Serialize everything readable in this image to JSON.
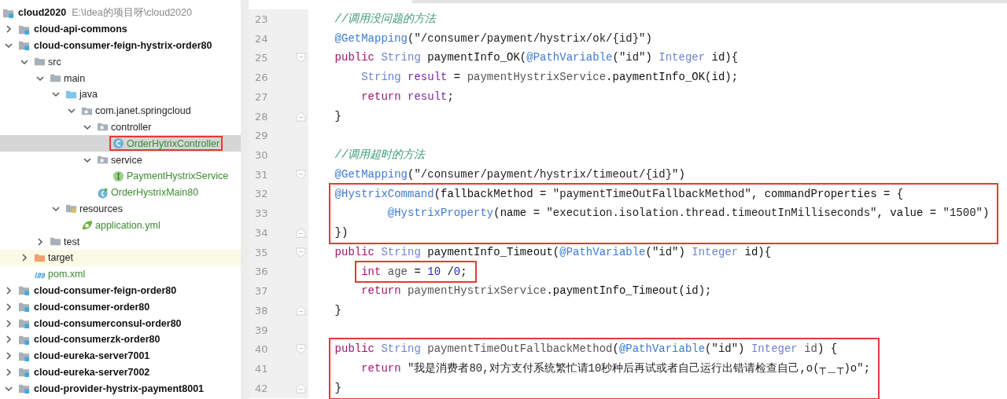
{
  "project": {
    "label": "cloud2020",
    "path": "E:\\Idea的项目呀\\cloud2020",
    "children": [
      {
        "label": "cloud-api-commons",
        "kind": "module",
        "expanded": false,
        "selected": false,
        "tinted": false,
        "boxed": false,
        "added": false
      },
      {
        "label": "cloud-consumer-feign-hystrix-order80",
        "kind": "module",
        "expanded": true,
        "selected": false,
        "tinted": false,
        "boxed": false,
        "added": false,
        "children": [
          {
            "label": "src",
            "kind": "folder",
            "expanded": true,
            "selected": false,
            "tinted": false,
            "boxed": false,
            "added": false,
            "children": [
              {
                "label": "main",
                "kind": "folder",
                "expanded": true,
                "selected": false,
                "tinted": false,
                "boxed": false,
                "added": false,
                "children": [
                  {
                    "label": "java",
                    "kind": "source-root",
                    "expanded": true,
                    "selected": false,
                    "tinted": false,
                    "boxed": false,
                    "added": false,
                    "children": [
                      {
                        "label": "com.janet.springcloud",
                        "kind": "package",
                        "expanded": true,
                        "selected": false,
                        "tinted": false,
                        "boxed": false,
                        "added": false,
                        "children": [
                          {
                            "label": "controller",
                            "kind": "package",
                            "expanded": true,
                            "selected": false,
                            "tinted": false,
                            "boxed": false,
                            "added": false,
                            "children": [
                              {
                                "label": "OrderHytrixController",
                                "kind": "class",
                                "selected": true,
                                "tinted": false,
                                "boxed": true,
                                "added": true
                              }
                            ]
                          },
                          {
                            "label": "service",
                            "kind": "package",
                            "expanded": true,
                            "selected": false,
                            "tinted": false,
                            "boxed": false,
                            "added": false,
                            "children": [
                              {
                                "label": "PaymentHystrixService",
                                "kind": "interface",
                                "selected": false,
                                "tinted": false,
                                "boxed": false,
                                "added": true
                              }
                            ]
                          },
                          {
                            "label": "OrderHystrixMain80",
                            "kind": "boot-class",
                            "selected": false,
                            "tinted": false,
                            "boxed": false,
                            "added": true
                          }
                        ]
                      }
                    ]
                  },
                  {
                    "label": "resources",
                    "kind": "resources-root",
                    "expanded": true,
                    "selected": false,
                    "tinted": false,
                    "boxed": false,
                    "added": false,
                    "children": [
                      {
                        "label": "application.yml",
                        "kind": "spring-config",
                        "selected": false,
                        "tinted": false,
                        "boxed": false,
                        "added": true
                      }
                    ]
                  }
                ]
              },
              {
                "label": "test",
                "kind": "folder",
                "expanded": false,
                "selected": false,
                "tinted": false,
                "boxed": false,
                "added": false
              }
            ]
          },
          {
            "label": "target",
            "kind": "excluded-folder",
            "expanded": false,
            "selected": false,
            "tinted": true,
            "boxed": false,
            "added": false
          },
          {
            "label": "pom.xml",
            "kind": "maven",
            "selected": false,
            "tinted": false,
            "boxed": false,
            "added": true
          }
        ]
      },
      {
        "label": "cloud-consumer-feign-order80",
        "kind": "module",
        "expanded": false,
        "selected": false,
        "tinted": false,
        "boxed": false,
        "added": false
      },
      {
        "label": "cloud-consumer-order80",
        "kind": "module",
        "expanded": false,
        "selected": false,
        "tinted": false,
        "boxed": false,
        "added": false
      },
      {
        "label": "cloud-consumerconsul-order80",
        "kind": "module",
        "expanded": false,
        "selected": false,
        "tinted": false,
        "boxed": false,
        "added": false
      },
      {
        "label": "cloud-consumerzk-order80",
        "kind": "module",
        "expanded": false,
        "selected": false,
        "tinted": false,
        "boxed": false,
        "added": false
      },
      {
        "label": "cloud-eureka-server7001",
        "kind": "module",
        "expanded": false,
        "selected": false,
        "tinted": false,
        "boxed": false,
        "added": false
      },
      {
        "label": "cloud-eureka-server7002",
        "kind": "module",
        "expanded": false,
        "selected": false,
        "tinted": false,
        "boxed": false,
        "added": false
      },
      {
        "label": "cloud-provider-hystrix-payment8001",
        "kind": "module",
        "expanded": true,
        "selected": false,
        "tinted": false,
        "boxed": false,
        "added": false
      }
    ]
  },
  "editor": {
    "blocks": [
      {
        "boxed": false,
        "lines": [
          {
            "number": "23",
            "kind": "code",
            "tokens": [
              {
                "kind": "comment",
                "text": "    //调用没问题的方法"
              }
            ]
          },
          {
            "number": "24",
            "kind": "code",
            "tokens": [
              {
                "kind": "ann",
                "text": "    @GetMapping"
              },
              {
                "kind": "plain",
                "text": "("
              },
              {
                "kind": "str",
                "text": "\"/consumer/payment/hystrix/ok/{id}\""
              },
              {
                "kind": "plain",
                "text": ")"
              }
            ]
          },
          {
            "number": "25",
            "kind": "fold-start",
            "tokens": [
              {
                "kind": "kw",
                "text": "    public"
              },
              {
                "kind": "type",
                "text": " String"
              },
              {
                "kind": "plain",
                "text": " paymentInfo_OK("
              },
              {
                "kind": "ann",
                "text": "@PathVariable"
              },
              {
                "kind": "plain",
                "text": "("
              },
              {
                "kind": "str",
                "text": "\"id\""
              },
              {
                "kind": "plain",
                "text": ") "
              },
              {
                "kind": "type",
                "text": "Integer"
              },
              {
                "kind": "plain",
                "text": " id){"
              }
            ]
          },
          {
            "number": "26",
            "kind": "code",
            "tokens": [
              {
                "kind": "type",
                "text": "        String"
              },
              {
                "kind": "field",
                "text": " result"
              },
              {
                "kind": "plain",
                "text": " = "
              },
              {
                "kind": "dim",
                "text": "paymentHystrixService"
              },
              {
                "kind": "plain",
                "text": ".paymentInfo_OK(id);"
              }
            ]
          },
          {
            "number": "27",
            "kind": "code",
            "tokens": [
              {
                "kind": "kw",
                "text": "        return"
              },
              {
                "kind": "field",
                "text": " result"
              },
              {
                "kind": "plain",
                "text": ";"
              }
            ]
          },
          {
            "number": "28",
            "kind": "fold-end",
            "tokens": [
              {
                "kind": "plain",
                "text": "    }"
              }
            ]
          },
          {
            "number": "29",
            "kind": "code"
          },
          {
            "number": "30",
            "kind": "code",
            "tokens": [
              {
                "kind": "comment",
                "text": "    //调用超时的方法"
              }
            ]
          },
          {
            "number": "31",
            "kind": "fold-start",
            "tokens": [
              {
                "kind": "ann",
                "text": "    @GetMapping"
              },
              {
                "kind": "plain",
                "text": "("
              },
              {
                "kind": "str",
                "text": "\"/consumer/payment/hystrix/timeout/{id}\""
              },
              {
                "kind": "plain",
                "text": ")"
              }
            ]
          }
        ]
      },
      {
        "boxed": true,
        "lines": [
          {
            "number": "32",
            "kind": "code",
            "tokens": [
              {
                "kind": "ann",
                "text": "    @HystrixCommand"
              },
              {
                "kind": "plain",
                "text": "(fallbackMethod = "
              },
              {
                "kind": "str",
                "text": "\"paymentTimeOutFallbackMethod\""
              },
              {
                "kind": "plain",
                "text": ", commandProperties = {"
              }
            ]
          },
          {
            "number": "33",
            "kind": "code",
            "tokens": [
              {
                "kind": "ann",
                "text": "            @HystrixProperty"
              },
              {
                "kind": "plain",
                "text": "(name = "
              },
              {
                "kind": "str",
                "text": "\"execution.isolation.thread.timeoutInMilliseconds\""
              },
              {
                "kind": "plain",
                "text": ", value = "
              },
              {
                "kind": "str",
                "text": "\"1500\""
              },
              {
                "kind": "plain",
                "text": ")"
              }
            ]
          },
          {
            "number": "34",
            "kind": "fold-end",
            "tokens": [
              {
                "kind": "plain",
                "text": "    })"
              }
            ]
          }
        ]
      },
      {
        "boxed": false,
        "lines": [
          {
            "number": "35",
            "kind": "fold-start",
            "tokens": [
              {
                "kind": "kw",
                "text": "    public"
              },
              {
                "kind": "type",
                "text": " String"
              },
              {
                "kind": "plain",
                "text": " paymentInfo_Timeout("
              },
              {
                "kind": "ann",
                "text": "@PathVariable"
              },
              {
                "kind": "plain",
                "text": "("
              },
              {
                "kind": "str",
                "text": "\"id\""
              },
              {
                "kind": "plain",
                "text": ") "
              },
              {
                "kind": "type",
                "text": "Integer"
              },
              {
                "kind": "plain",
                "text": " id){"
              }
            ]
          }
        ]
      },
      {
        "boxed": true,
        "lines": [
          {
            "number": "36",
            "kind": "code",
            "tokens": [
              {
                "kind": "kw",
                "text": "        int"
              },
              {
                "kind": "dim",
                "text": " age"
              },
              {
                "kind": "plain",
                "text": " = "
              },
              {
                "kind": "num",
                "text": "10"
              },
              {
                "kind": "plain",
                "text": " /"
              },
              {
                "kind": "num",
                "text": "0"
              },
              {
                "kind": "plain",
                "text": ";"
              }
            ]
          }
        ]
      },
      {
        "boxed": false,
        "lines": [
          {
            "number": "37",
            "kind": "code",
            "tokens": [
              {
                "kind": "kw",
                "text": "        return"
              },
              {
                "kind": "dim",
                "text": " paymentHystrixService"
              },
              {
                "kind": "plain",
                "text": ".paymentInfo_Timeout(id);"
              }
            ]
          },
          {
            "number": "38",
            "kind": "fold-end",
            "tokens": [
              {
                "kind": "plain",
                "text": "    }"
              }
            ]
          },
          {
            "number": "39",
            "kind": "code"
          }
        ]
      },
      {
        "boxed": true,
        "lines": [
          {
            "number": "40",
            "kind": "fold-start",
            "tokens": [
              {
                "kind": "kw",
                "text": "    public"
              },
              {
                "kind": "type",
                "text": " String"
              },
              {
                "kind": "dim",
                "text": " paymentTimeOutFallbackMethod"
              },
              {
                "kind": "plain",
                "text": "("
              },
              {
                "kind": "ann",
                "text": "@PathVariable"
              },
              {
                "kind": "plain",
                "text": "("
              },
              {
                "kind": "str",
                "text": "\"id\""
              },
              {
                "kind": "plain",
                "text": ") "
              },
              {
                "kind": "type",
                "text": "Integer"
              },
              {
                "kind": "dim",
                "text": " id"
              },
              {
                "kind": "plain",
                "text": ") {"
              }
            ]
          },
          {
            "number": "41",
            "kind": "code",
            "tokens": [
              {
                "kind": "kw",
                "text": "        return"
              },
              {
                "kind": "str",
                "text": " \"我是消费者80,对方支付系统繁忙请10秒种后再试或者自己运行出错请检查自己,o(┬＿┬)o\""
              },
              {
                "kind": "plain",
                "text": ";"
              }
            ]
          },
          {
            "number": "42",
            "kind": "fold-end",
            "tokens": [
              {
                "kind": "plain",
                "text": "    }"
              }
            ]
          }
        ]
      }
    ]
  }
}
